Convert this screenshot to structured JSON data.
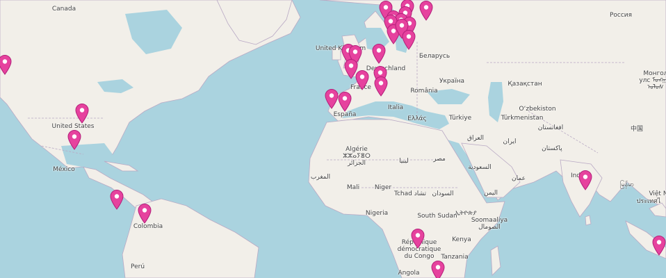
{
  "map": {
    "marker_color": "#e6429e",
    "marker_count": 39,
    "labels": [
      {
        "key": "canada",
        "text": "Canada"
      },
      {
        "key": "united-states",
        "text": "United States"
      },
      {
        "key": "mexico",
        "text": "México"
      },
      {
        "key": "colombia",
        "text": "Colombia"
      },
      {
        "key": "peru",
        "text": "Perú"
      },
      {
        "key": "united-kingdom",
        "text": "United Kingdom"
      },
      {
        "key": "deutschland",
        "text": "Deutschland"
      },
      {
        "key": "france",
        "text": "France"
      },
      {
        "key": "espana",
        "text": "España"
      },
      {
        "key": "italia",
        "text": "Italia"
      },
      {
        "key": "belarus",
        "text": "Беларусь"
      },
      {
        "key": "ukraina",
        "text": "Україна"
      },
      {
        "key": "romania",
        "text": "România"
      },
      {
        "key": "ellada",
        "text": "Ελλάς"
      },
      {
        "key": "turkiye",
        "text": "Türkiye"
      },
      {
        "key": "rossiya",
        "text": "Россия"
      },
      {
        "key": "kazakhstan",
        "text": "Қазақстан"
      },
      {
        "key": "uzbekiston",
        "text": "O‘zbekiston"
      },
      {
        "key": "turkmenistan",
        "text": "Türkmenistan"
      },
      {
        "key": "afghanistan",
        "text": "افغانستان"
      },
      {
        "key": "pakistan",
        "text": "پاکستان"
      },
      {
        "key": "iran",
        "text": "ایران"
      },
      {
        "key": "iraq",
        "text": "العراق"
      },
      {
        "key": "saudi",
        "text": "السعودية"
      },
      {
        "key": "oman",
        "text": "عمان"
      },
      {
        "key": "yemen",
        "text": "اليمن"
      },
      {
        "key": "china",
        "text": "中国"
      },
      {
        "key": "mongolia",
        "text": "Монгол\nулс ᠮᠣᠩᠭᠣᠯ\nᠤᠯᠤᠰ"
      },
      {
        "key": "india",
        "text": "India"
      },
      {
        "key": "myanmar",
        "text": "မြန်မာ"
      },
      {
        "key": "vietnam",
        "text": "Việt N"
      },
      {
        "key": "thailand",
        "text": "ประเทศไ"
      },
      {
        "key": "algerie",
        "text": "Algérie\nⵣⵣⴰⵢⴻⵔ\nالجزائر"
      },
      {
        "key": "libya",
        "text": "ليبيا"
      },
      {
        "key": "misr",
        "text": "مصر"
      },
      {
        "key": "morocco",
        "text": "المغرب"
      },
      {
        "key": "mali",
        "text": "Mali"
      },
      {
        "key": "niger",
        "text": "Niger"
      },
      {
        "key": "tchad",
        "text": "Tchad تشاد"
      },
      {
        "key": "sudan",
        "text": "السودان"
      },
      {
        "key": "ethiopia",
        "text": "ኢትዮጵያ"
      },
      {
        "key": "nigeria",
        "text": "Nigeria"
      },
      {
        "key": "south-sudan",
        "text": "South Sudan"
      },
      {
        "key": "somalia",
        "text": "Soomaaliya\nالصومال"
      },
      {
        "key": "drc",
        "text": "République\ndémocratique\ndu Congo"
      },
      {
        "key": "kenya",
        "text": "Kenya"
      },
      {
        "key": "tanzania",
        "text": "Tanzania"
      },
      {
        "key": "angola",
        "text": "Angola"
      }
    ]
  }
}
